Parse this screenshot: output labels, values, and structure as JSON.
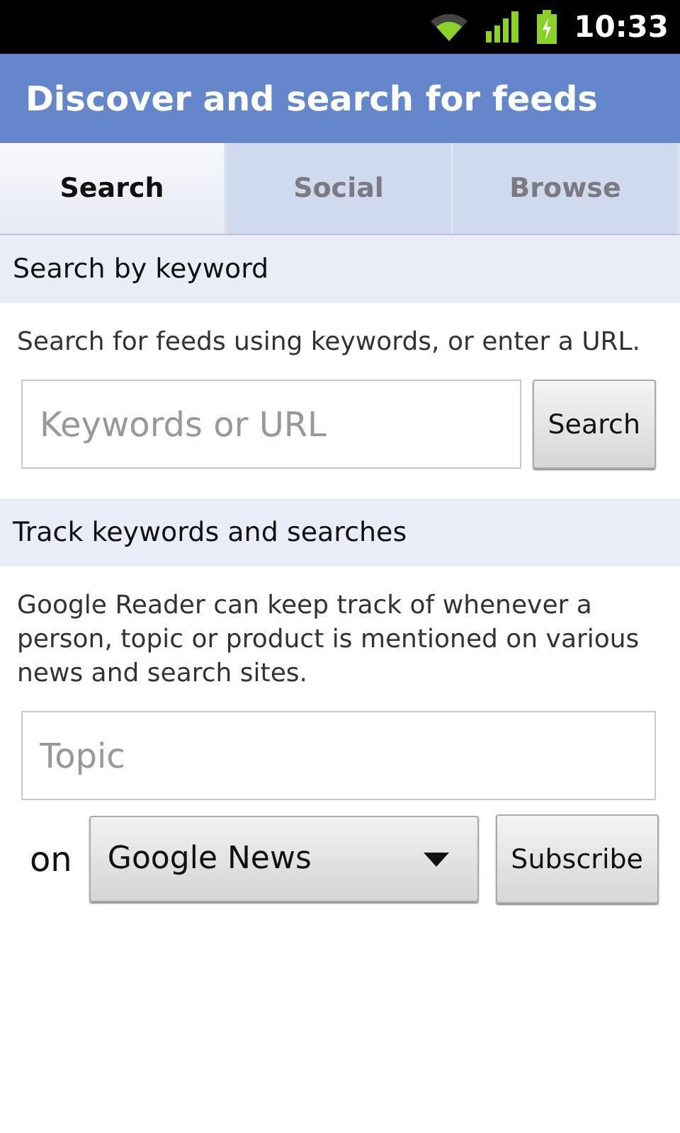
{
  "status_bar": {
    "time": "10:33"
  },
  "title": "Discover and search for feeds",
  "tabs": [
    {
      "label": "Search",
      "selected": true
    },
    {
      "label": "Social",
      "selected": false
    },
    {
      "label": "Browse",
      "selected": false
    }
  ],
  "keyword_section": {
    "header": "Search by keyword",
    "description": "Search for feeds using keywords, or enter a URL.",
    "field": {
      "placeholder": "Keywords or URL"
    },
    "button": "Search"
  },
  "track_section": {
    "header": "Track keywords and searches",
    "description": "Google Reader can keep track of whenever a person, topic or product is mentioned on various news and search sites.",
    "field": {
      "placeholder": "Topic"
    },
    "on_label": "on",
    "source": "Google News",
    "button": "Subscribe"
  }
}
